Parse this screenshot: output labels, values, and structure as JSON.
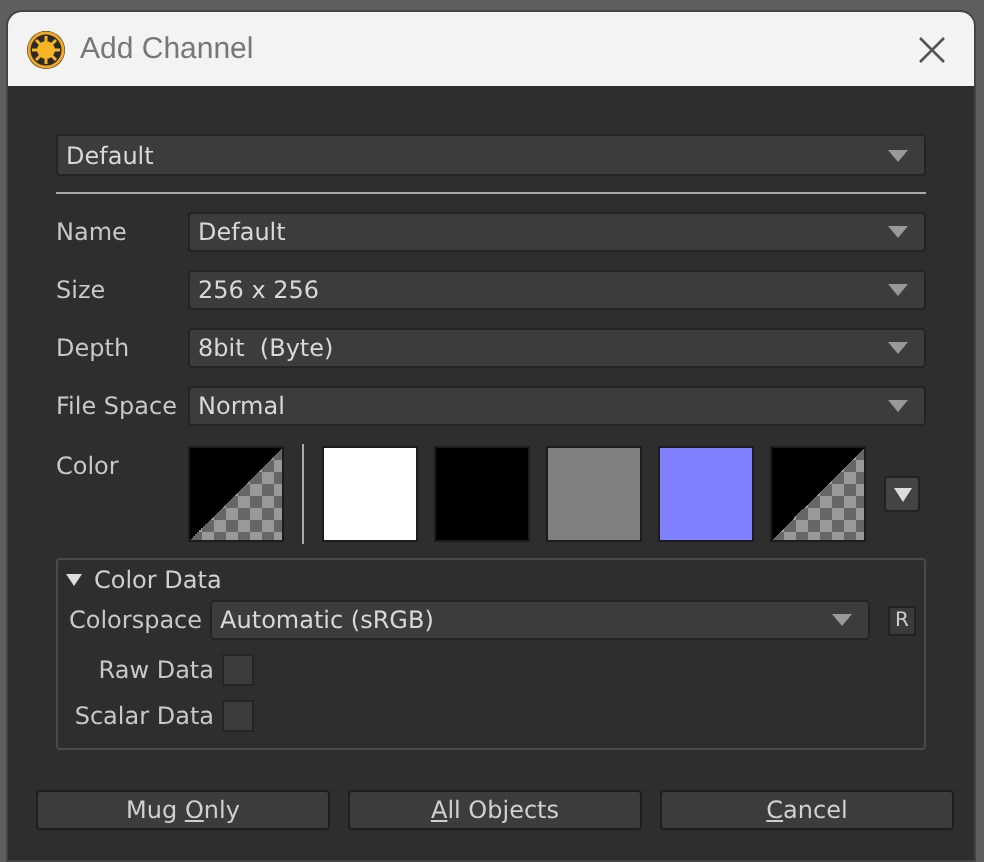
{
  "window": {
    "title": "Add Channel"
  },
  "preset": {
    "value": "Default"
  },
  "fields": [
    {
      "label": "Name",
      "value": "Default"
    },
    {
      "label": "Size",
      "value": "256 x 256"
    },
    {
      "label": "Depth",
      "value": "8bit  (Byte)"
    },
    {
      "label": "File Space",
      "value": "Normal"
    }
  ],
  "color": {
    "label": "Color",
    "current": {
      "kind": "transparent"
    },
    "swatches": [
      {
        "kind": "solid",
        "color": "#ffffff"
      },
      {
        "kind": "solid",
        "color": "#000000"
      },
      {
        "kind": "solid",
        "color": "#808080"
      },
      {
        "kind": "solid",
        "color": "#8080ff"
      },
      {
        "kind": "transparent"
      }
    ]
  },
  "color_data": {
    "title": "Color Data",
    "expanded": true,
    "colorspace": {
      "label": "Colorspace",
      "value": "Automatic (sRGB)",
      "reset": "R"
    },
    "checks": [
      {
        "label": "Raw Data",
        "checked": false
      },
      {
        "label": "Scalar Data",
        "checked": false
      }
    ]
  },
  "buttons": [
    {
      "before": "Mug ",
      "key": "O",
      "after": "nly"
    },
    {
      "key": "A",
      "after": "ll Objects"
    },
    {
      "key": "C",
      "after": "ancel"
    }
  ]
}
